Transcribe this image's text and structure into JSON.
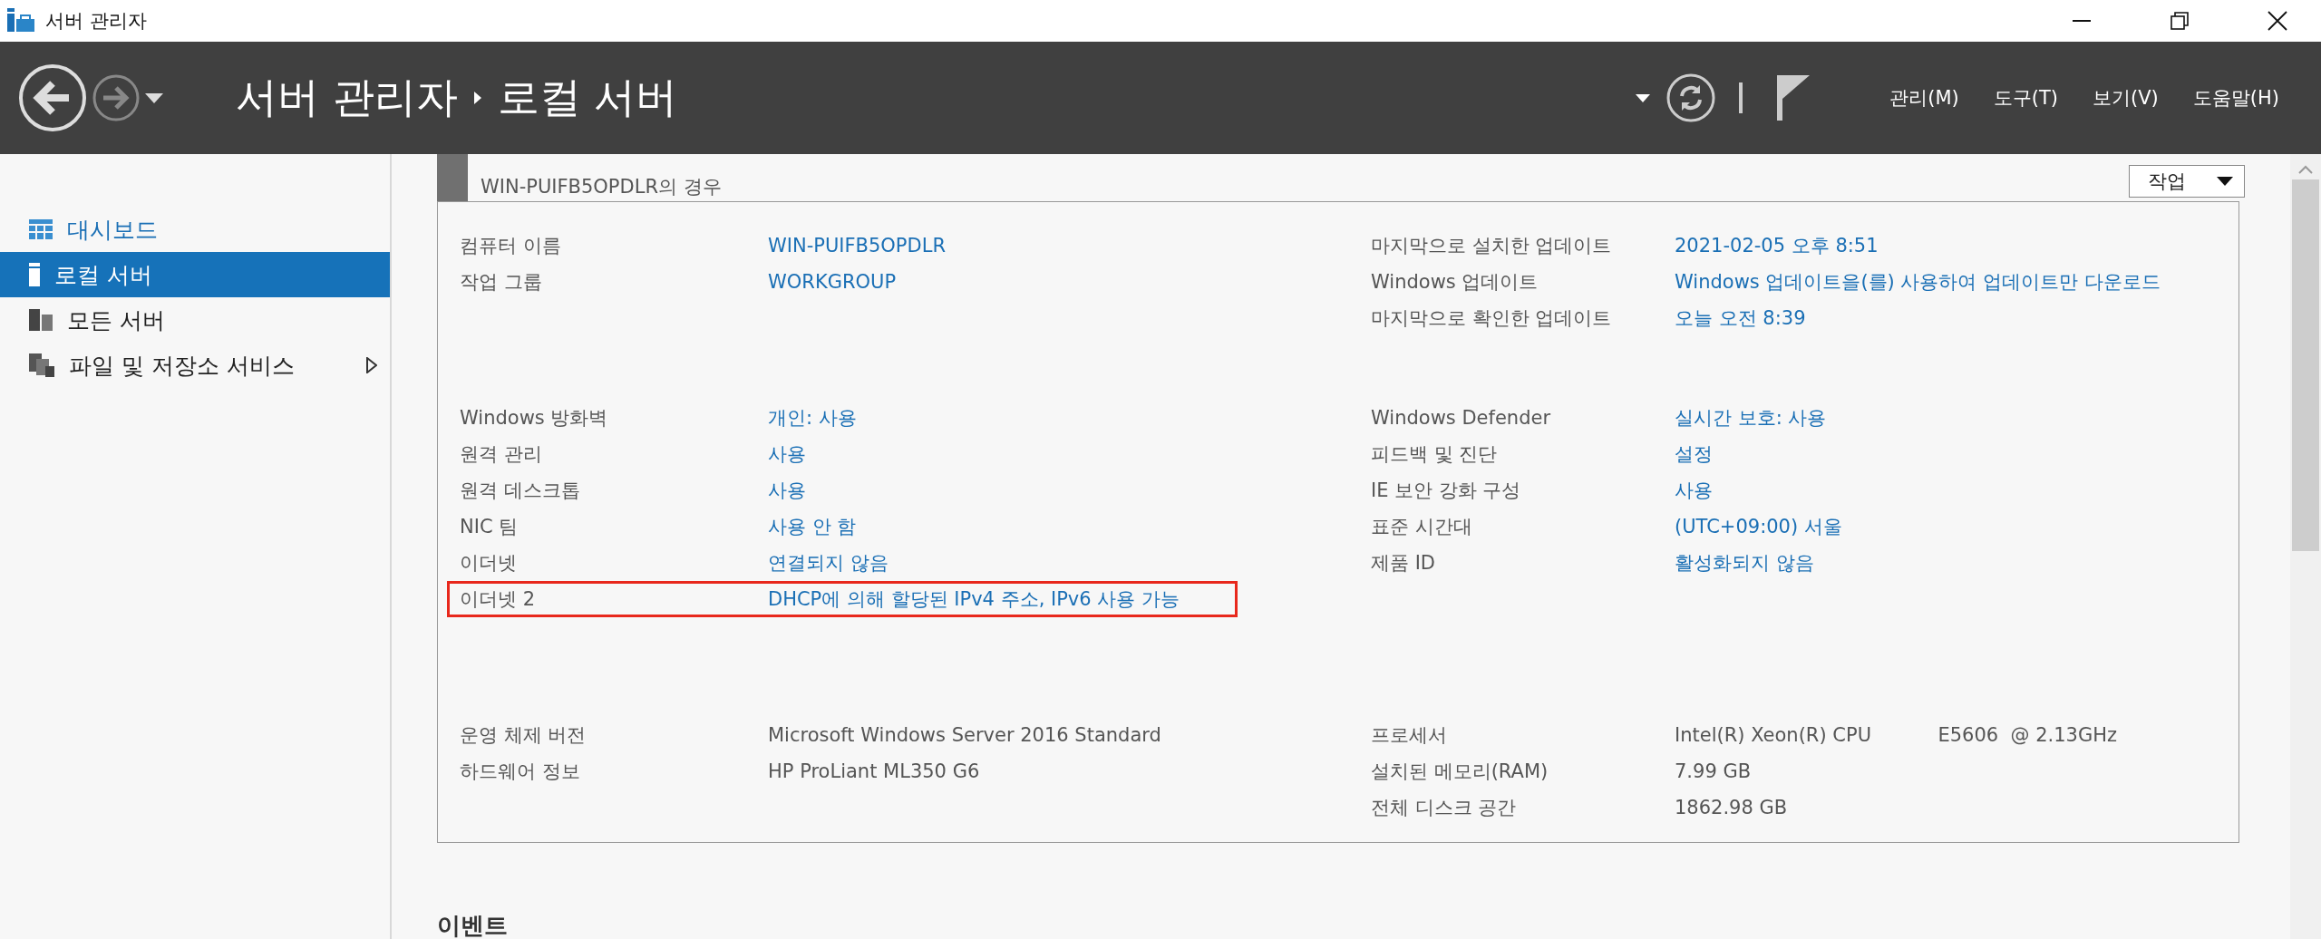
{
  "window": {
    "title": "서버 관리자"
  },
  "header": {
    "breadcrumb": [
      "서버 관리자",
      "로컬 서버"
    ],
    "menu": [
      "관리(M)",
      "도구(T)",
      "보기(V)",
      "도움말(H)"
    ]
  },
  "sidebar": {
    "items": [
      {
        "label": "대시보드",
        "kind": "dashboard",
        "selected": false,
        "has_submenu": false
      },
      {
        "label": "로컬 서버",
        "kind": "server",
        "selected": true,
        "has_submenu": false
      },
      {
        "label": "모든 서버",
        "kind": "servers",
        "selected": false,
        "has_submenu": false
      },
      {
        "label": "파일 및 저장소 서비스",
        "kind": "files",
        "selected": false,
        "has_submenu": true
      }
    ]
  },
  "properties": {
    "subtitle": "WIN-PUIFB5OPDLR의 경우",
    "tasks_button": "작업",
    "groups": [
      {
        "left": [
          {
            "label": "컴퓨터 이름",
            "value": "WIN-PUIFB5OPDLR",
            "kind": "link",
            "highlighted": false
          },
          {
            "label": "작업 그룹",
            "value": "WORKGROUP",
            "kind": "link",
            "highlighted": false
          }
        ],
        "right": [
          {
            "label": "마지막으로 설치한 업데이트",
            "value": "2021-02-05 오후 8:51",
            "kind": "link"
          },
          {
            "label": "Windows 업데이트",
            "value": "Windows 업데이트을(를) 사용하여 업데이트만 다운로드",
            "kind": "link"
          },
          {
            "label": "마지막으로 확인한 업데이트",
            "value": "오늘 오전 8:39",
            "kind": "link"
          }
        ]
      },
      {
        "left": [
          {
            "label": "Windows 방화벽",
            "value": "개인: 사용",
            "kind": "link",
            "highlighted": false
          },
          {
            "label": "원격 관리",
            "value": "사용",
            "kind": "link",
            "highlighted": false
          },
          {
            "label": "원격 데스크톱",
            "value": "사용",
            "kind": "link",
            "highlighted": false
          },
          {
            "label": "NIC 팀",
            "value": "사용 안 함",
            "kind": "link",
            "highlighted": false
          },
          {
            "label": "이더넷",
            "value": "연결되지 않음",
            "kind": "link",
            "highlighted": false
          },
          {
            "label": "이더넷 2",
            "value": "DHCP에 의해 할당된 IPv4 주소, IPv6 사용 가능",
            "kind": "link",
            "highlighted": true
          }
        ],
        "right": [
          {
            "label": "Windows Defender",
            "value": "실시간 보호: 사용",
            "kind": "link"
          },
          {
            "label": "피드백 및 진단",
            "value": "설정",
            "kind": "link"
          },
          {
            "label": "IE 보안 강화 구성",
            "value": "사용",
            "kind": "link"
          },
          {
            "label": "표준 시간대",
            "value": "(UTC+09:00) 서울",
            "kind": "link"
          },
          {
            "label": "제품 ID",
            "value": "활성화되지 않음",
            "kind": "link"
          }
        ]
      },
      {
        "left": [
          {
            "label": "운영 체제 버전",
            "value": "Microsoft Windows Server 2016 Standard",
            "kind": "text",
            "highlighted": false
          },
          {
            "label": "하드웨어 정보",
            "value": "HP ProLiant ML350 G6",
            "kind": "text",
            "highlighted": false
          }
        ],
        "right": [
          {
            "label": "프로세서",
            "value": "Intel(R) Xeon(R) CPU           E5606  @ 2.13GHz",
            "kind": "text"
          },
          {
            "label": "설치된 메모리(RAM)",
            "value": "7.99 GB",
            "kind": "text"
          },
          {
            "label": "전체 디스크 공간",
            "value": "1862.98 GB",
            "kind": "text"
          }
        ]
      }
    ]
  },
  "events": {
    "title": "이벤트"
  }
}
